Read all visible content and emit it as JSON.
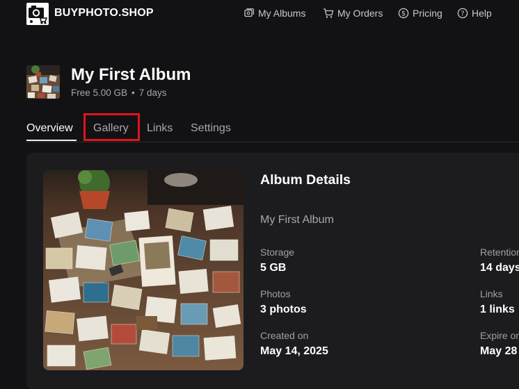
{
  "nav": {
    "brand": "BUYPHOTO.SHOP",
    "links": [
      {
        "label": "My Albums",
        "icon": "albums-icon"
      },
      {
        "label": "My Orders",
        "icon": "cart-icon"
      },
      {
        "label": "Pricing",
        "icon": "dollar-circle-icon"
      },
      {
        "label": "Help",
        "icon": "help-circle-icon"
      }
    ]
  },
  "album": {
    "title": "My First Album",
    "plan": "Free 5.00 GB",
    "separator": "•",
    "duration": "7 days"
  },
  "tabs": [
    {
      "label": "Overview",
      "active": true
    },
    {
      "label": "Gallery",
      "active": false
    },
    {
      "label": "Links",
      "active": false
    },
    {
      "label": "Settings",
      "active": false
    }
  ],
  "details": {
    "title": "Album Details",
    "name": "My First Album",
    "storage_label": "Storage",
    "storage_value": "5 GB",
    "retention_label": "Retention",
    "retention_value": "14 days",
    "photos_label": "Photos",
    "photos_value": "3 photos",
    "links_label": "Links",
    "links_value": "1 links",
    "created_label": "Created on",
    "created_value": "May 14, 2025",
    "expire_label": "Expire on",
    "expire_value": "May 28"
  },
  "colors": {
    "background": "#121214",
    "card": "#1c1c1f",
    "highlight": "#e0141b"
  }
}
